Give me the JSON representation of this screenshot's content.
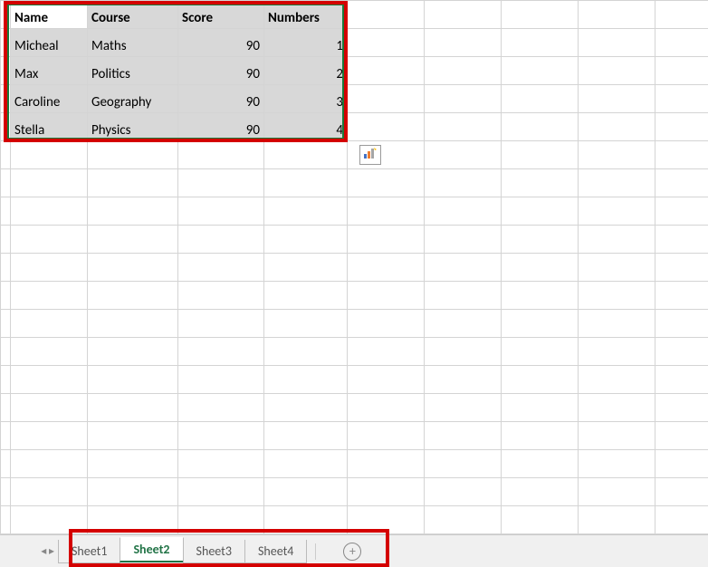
{
  "table": {
    "headers": [
      "Name",
      "Course",
      "Score",
      "Numbers"
    ],
    "rows": [
      {
        "name": "Micheal",
        "course": "Maths",
        "score": 90,
        "number": 1
      },
      {
        "name": "Max",
        "course": "Politics",
        "score": 90,
        "number": 2
      },
      {
        "name": "Caroline",
        "course": "Geography",
        "score": 90,
        "number": 3
      },
      {
        "name": "Stella",
        "course": "Physics",
        "score": 90,
        "number": 4
      }
    ]
  },
  "icons": {
    "quick_analysis": "quick-analysis-icon"
  },
  "tabs": {
    "items": [
      "Sheet1",
      "Sheet2",
      "Sheet3",
      "Sheet4"
    ],
    "active_index": 1,
    "add_label": "+"
  },
  "nav": {
    "prev": "◂",
    "next": "▸"
  }
}
